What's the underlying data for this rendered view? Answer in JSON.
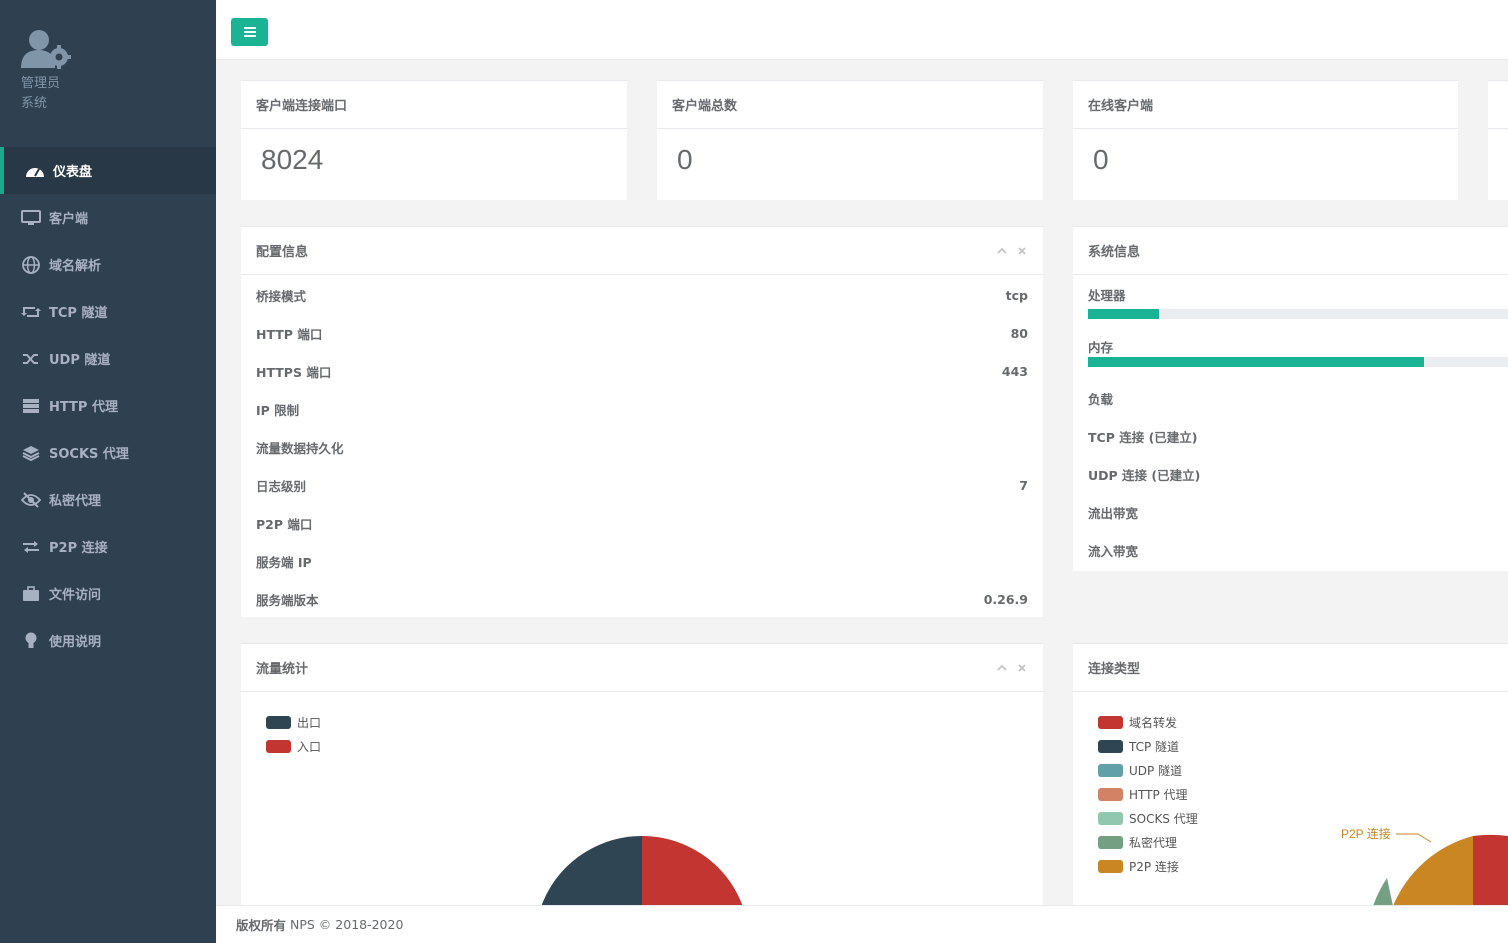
{
  "sidebar": {
    "profile": {
      "line1": "管理员",
      "line2": "系统"
    },
    "items": [
      {
        "label": "仪表盘",
        "icon": "dashboard-icon",
        "active": true
      },
      {
        "label": "客户端",
        "icon": "desktop-icon"
      },
      {
        "label": "域名解析",
        "icon": "globe-icon"
      },
      {
        "label": "TCP 隧道",
        "icon": "retweet-icon"
      },
      {
        "label": "UDP 隧道",
        "icon": "random-icon"
      },
      {
        "label": "HTTP 代理",
        "icon": "server-icon"
      },
      {
        "label": "SOCKS 代理",
        "icon": "layers-icon"
      },
      {
        "label": "私密代理",
        "icon": "eye-slash-icon"
      },
      {
        "label": "P2P 连接",
        "icon": "exchange-icon"
      },
      {
        "label": "文件访问",
        "icon": "briefcase-icon"
      },
      {
        "label": "使用说明",
        "icon": "lightbulb-icon"
      }
    ]
  },
  "stats": [
    {
      "title": "客户端连接端口",
      "value": "8024"
    },
    {
      "title": "客户端总数",
      "value": "0"
    },
    {
      "title": "在线客户端",
      "value": "0"
    }
  ],
  "config": {
    "title": "配置信息",
    "rows": [
      {
        "label": "桥接模式",
        "value": "tcp"
      },
      {
        "label": "HTTP 端口",
        "value": "80"
      },
      {
        "label": "HTTPS 端口",
        "value": "443"
      },
      {
        "label": "IP 限制",
        "value": ""
      },
      {
        "label": "流量数据持久化",
        "value": ""
      },
      {
        "label": "日志级别",
        "value": "7"
      },
      {
        "label": "P2P 端口",
        "value": ""
      },
      {
        "label": "服务端 IP",
        "value": ""
      },
      {
        "label": "服务端版本",
        "value": "0.26.9"
      }
    ]
  },
  "system": {
    "title": "系统信息",
    "cpu_label": "处理器",
    "cpu_percent": 17,
    "mem_label": "内存",
    "mem_percent": 80,
    "rows": [
      "负载",
      "TCP 连接 (已建立)",
      "UDP 连接 (已建立)",
      "流出带宽",
      "流入带宽"
    ]
  },
  "traffic": {
    "title": "流量统计",
    "legend": [
      {
        "name": "出口",
        "color": "#2f4554"
      },
      {
        "name": "入口",
        "color": "#c23531"
      }
    ]
  },
  "conn": {
    "title": "连接类型",
    "legend": [
      {
        "name": "域名转发",
        "color": "#c23531"
      },
      {
        "name": "TCP 隧道",
        "color": "#2f4554"
      },
      {
        "name": "UDP 隧道",
        "color": "#61a0a8"
      },
      {
        "name": "HTTP 代理",
        "color": "#d48265"
      },
      {
        "name": "SOCKS 代理",
        "color": "#91c7ae"
      },
      {
        "name": "私密代理",
        "color": "#749f83"
      },
      {
        "name": "P2P 连接",
        "color": "#ca8622"
      }
    ],
    "pie_label": "P2P 连接"
  },
  "footer": {
    "strong": "版权所有",
    "text": "NPS © 2018-2020"
  },
  "colors": {
    "sidebar": "#2f4050",
    "accent": "#1ab394"
  }
}
